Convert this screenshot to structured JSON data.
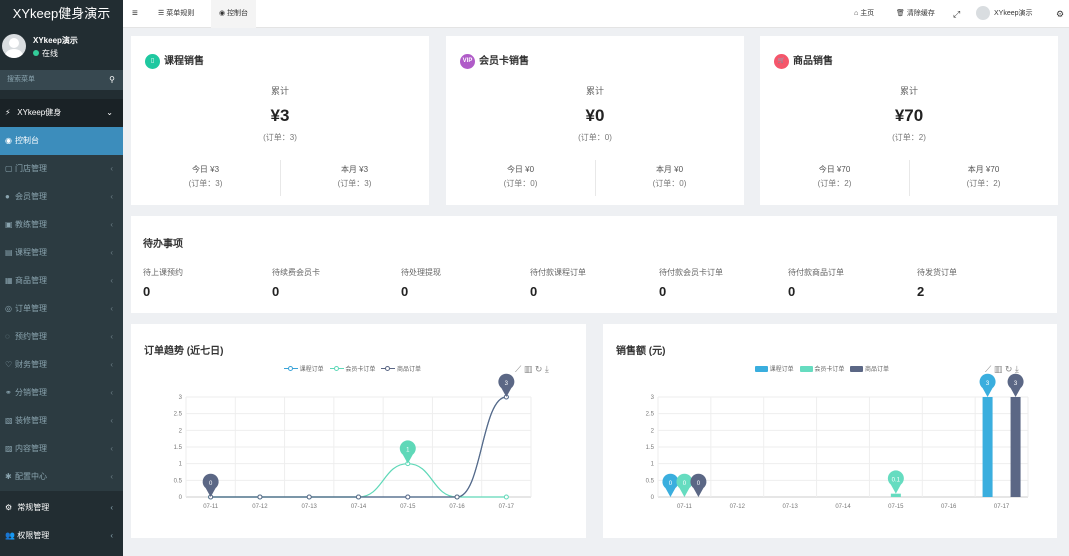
{
  "sidebar": {
    "brand": "XYkeep健身演示",
    "user_name": "XYkeep演示",
    "user_status": "在线",
    "search_placeholder": "搜索菜单",
    "group_label": "XYkeep健身",
    "items": [
      {
        "label": "控制台",
        "icon": "dashboard-icon"
      },
      {
        "label": "门店管理",
        "icon": "store-icon"
      },
      {
        "label": "会员管理",
        "icon": "member-icon"
      },
      {
        "label": "教练管理",
        "icon": "coach-icon"
      },
      {
        "label": "课程管理",
        "icon": "course-icon"
      },
      {
        "label": "商品管理",
        "icon": "goods-icon"
      },
      {
        "label": "订单管理",
        "icon": "order-icon"
      },
      {
        "label": "预约管理",
        "icon": "booking-icon"
      },
      {
        "label": "财务管理",
        "icon": "finance-icon"
      },
      {
        "label": "分销管理",
        "icon": "distribution-icon"
      },
      {
        "label": "装修管理",
        "icon": "decor-icon"
      },
      {
        "label": "内容管理",
        "icon": "content-icon"
      },
      {
        "label": "配置中心",
        "icon": "config-icon"
      }
    ],
    "bottom_items": [
      {
        "label": "常规管理",
        "icon": "settings-icon"
      },
      {
        "label": "权限管理",
        "icon": "permission-icon"
      }
    ]
  },
  "topbar": {
    "tab_menu_rules": "菜单规则",
    "tab_dashboard": "控制台",
    "home": "主页",
    "clear_cache": "清除缓存",
    "user_name": "XYkeep演示"
  },
  "sales_cards": [
    {
      "title": "课程销售",
      "color": "#1fc8a0",
      "total_label": "累计",
      "total": "¥3",
      "total_orders": "(订单：3)",
      "today": "今日 ¥3",
      "today_orders": "(订单：3)",
      "month": "本月 ¥3",
      "month_orders": "(订单：3)"
    },
    {
      "title": "会员卡销售",
      "color": "#b05cc8",
      "total_label": "累计",
      "total": "¥0",
      "total_orders": "(订单：0)",
      "today": "今日 ¥0",
      "today_orders": "(订单：0)",
      "month": "本月 ¥0",
      "month_orders": "(订单：0)"
    },
    {
      "title": "商品销售",
      "color": "#f5566b",
      "total_label": "累计",
      "total": "¥70",
      "total_orders": "(订单：2)",
      "today": "今日 ¥70",
      "today_orders": "(订单：2)",
      "month": "本月 ¥70",
      "month_orders": "(订单：2)"
    }
  ],
  "todo": {
    "title": "待办事项",
    "items": [
      {
        "label": "待上课预约",
        "value": "0"
      },
      {
        "label": "待续费会员卡",
        "value": "0"
      },
      {
        "label": "待处理提现",
        "value": "0"
      },
      {
        "label": "待付款课程订单",
        "value": "0"
      },
      {
        "label": "待付款会员卡订单",
        "value": "0"
      },
      {
        "label": "待付款商品订单",
        "value": "0"
      },
      {
        "label": "待发货订单",
        "value": "2"
      }
    ]
  },
  "chart_data": [
    {
      "type": "line",
      "title": "订单趋势 (近七日)",
      "x": [
        "07-11",
        "07-12",
        "07-13",
        "07-14",
        "07-15",
        "07-16",
        "07-17"
      ],
      "ylim": [
        0,
        3
      ],
      "yticks": [
        "0",
        "0.5",
        "1",
        "1.5",
        "2",
        "2.5",
        "3"
      ],
      "series": [
        {
          "name": "课程订单",
          "color": "#3aa3d8",
          "values": [
            0,
            0,
            0,
            0,
            0,
            0,
            3
          ]
        },
        {
          "name": "会员卡订单",
          "color": "#5fd8b8",
          "values": [
            0,
            0,
            0,
            0,
            1,
            0,
            0
          ]
        },
        {
          "name": "商品订单",
          "color": "#5b6785",
          "values": [
            0,
            0,
            0,
            0,
            0,
            0,
            3
          ]
        }
      ],
      "markers": [
        {
          "x": "07-11",
          "value": "0",
          "color": "#5b6785"
        },
        {
          "x": "07-15",
          "value": "1",
          "color": "#5fd8b8"
        },
        {
          "x": "07-17",
          "value": "3",
          "color": "#5b6785"
        }
      ]
    },
    {
      "type": "bar",
      "title": "销售额 (元)",
      "categories": [
        "07-11",
        "07-12",
        "07-13",
        "07-14",
        "07-15",
        "07-16",
        "07-17"
      ],
      "ylim": [
        0,
        3
      ],
      "yticks": [
        "0",
        "0.5",
        "1",
        "1.5",
        "2",
        "2.5",
        "3"
      ],
      "series": [
        {
          "name": "课程订单",
          "color": "#3aaede",
          "values": [
            0,
            0,
            0,
            0,
            0,
            0,
            3
          ]
        },
        {
          "name": "会员卡订单",
          "color": "#66dcc0",
          "values": [
            0,
            0,
            0,
            0,
            0.1,
            0,
            0
          ]
        },
        {
          "name": "商品订单",
          "color": "#5b6785",
          "values": [
            0,
            0,
            0,
            0,
            0,
            0,
            3
          ]
        }
      ],
      "markers": [
        {
          "x": "07-11",
          "series": 0,
          "value": "0",
          "color": "#3aaede"
        },
        {
          "x": "07-11",
          "series": 1,
          "value": "0",
          "color": "#66dcc0"
        },
        {
          "x": "07-11",
          "series": 2,
          "value": "0",
          "color": "#5b6785"
        },
        {
          "x": "07-15",
          "series": 1,
          "value": "0.1",
          "color": "#66dcc0"
        },
        {
          "x": "07-17",
          "series": 0,
          "value": "3",
          "color": "#3aaede"
        },
        {
          "x": "07-17",
          "series": 2,
          "value": "3",
          "color": "#5b6785"
        }
      ]
    }
  ]
}
